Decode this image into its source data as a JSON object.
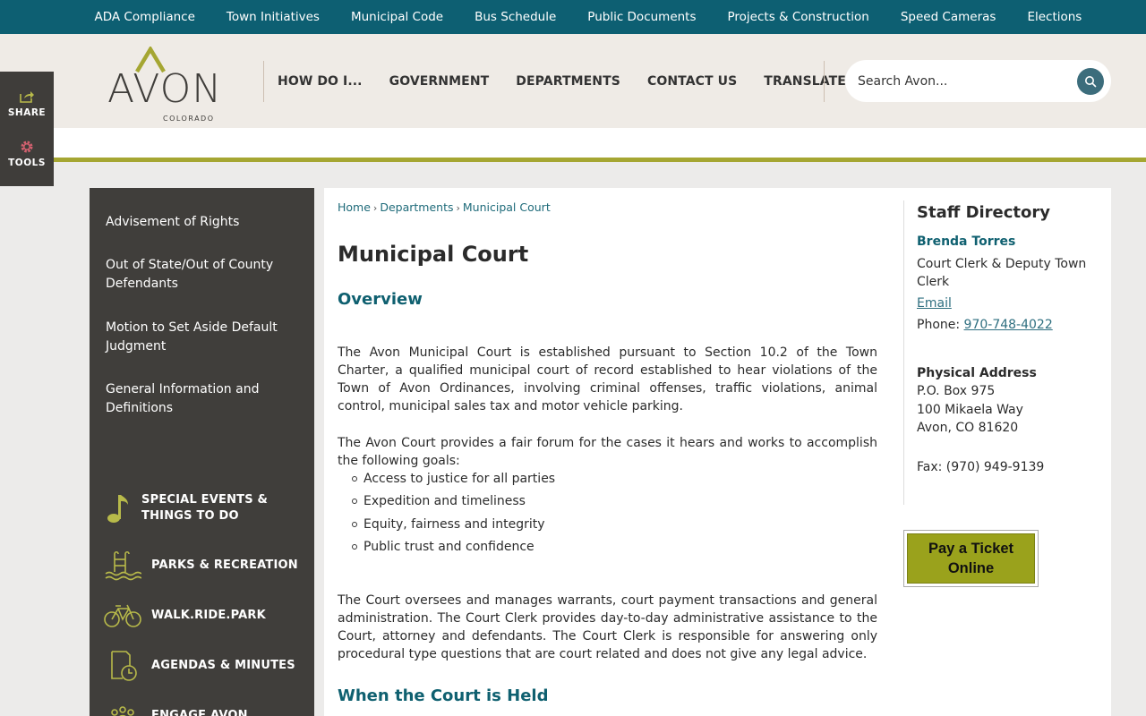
{
  "utility_nav": [
    "ADA Compliance",
    "Town Initiatives",
    "Municipal Code",
    "Bus Schedule",
    "Public Documents",
    "Projects & Construction",
    "Speed Cameras",
    "Elections"
  ],
  "logo": {
    "word": "AVON",
    "sub": "COLORADO"
  },
  "main_nav": [
    "HOW DO I...",
    "GOVERNMENT",
    "DEPARTMENTS",
    "CONTACT US",
    "TRANSLATE"
  ],
  "search": {
    "placeholder": "Search Avon..."
  },
  "side_tools": {
    "share": "SHARE",
    "tools": "TOOLS"
  },
  "left_menu": [
    "Advisement of Rights",
    "Out of State/Out of County Defendants",
    "Motion to Set Aside Default Judgment",
    "General Information and Definitions"
  ],
  "quick_links": [
    {
      "label": "SPECIAL EVENTS & THINGS TO DO",
      "icon": "music-note-icon"
    },
    {
      "label": "PARKS & RECREATION",
      "icon": "pool-icon"
    },
    {
      "label": "WALK.RIDE.PARK",
      "icon": "bicycle-icon"
    },
    {
      "label": "AGENDAS & MINUTES",
      "icon": "document-clock-icon"
    },
    {
      "label": "ENGAGE AVON",
      "icon": "people-icon"
    }
  ],
  "breadcrumb": [
    "Home",
    "Departments",
    "Municipal Court"
  ],
  "page_title": "Municipal Court",
  "overview_heading": "Overview",
  "para1": "The Avon Municipal Court is established pursuant to Section 10.2 of the Town Charter, a qualified municipal court of record established to hear violations of the Town of Avon Ordinances, involving criminal offenses, traffic violations, animal control, municipal sales tax and motor vehicle parking.",
  "para2": "The Avon Court provides a fair forum for the cases it hears and works to accomplish the following goals:",
  "goals": [
    "Access to justice for all parties",
    "Expedition and timeliness",
    "Equity, fairness and integrity",
    "Public trust and confidence"
  ],
  "para3": "The Court oversees and manages warrants, court payment transactions and general administration. The Court Clerk provides day-to-day administrative assistance to the Court, attorney and defendants. The Court Clerk is responsible for answering only procedural type questions that are court related and does not give any legal advice.",
  "held_heading": "When the Court is Held",
  "staff": {
    "title": "Staff Directory",
    "name": "Brenda Torres",
    "role": "Court Clerk & Deputy Town Clerk",
    "email_label": "Email",
    "phone_label": "Phone:",
    "phone": "970-748-4022",
    "address_heading": "Physical Address",
    "address_lines": [
      "P.O. Box 975",
      "100 Mikaela Way",
      "Avon, CO 81620"
    ],
    "fax": "Fax: (970) 949-9139"
  },
  "pay_ticket": "Pay a Ticket Online",
  "colors": {
    "teal": "#0d5f72",
    "olive": "#a5a632",
    "dark": "#403e3b",
    "button": "#9aa21c"
  }
}
